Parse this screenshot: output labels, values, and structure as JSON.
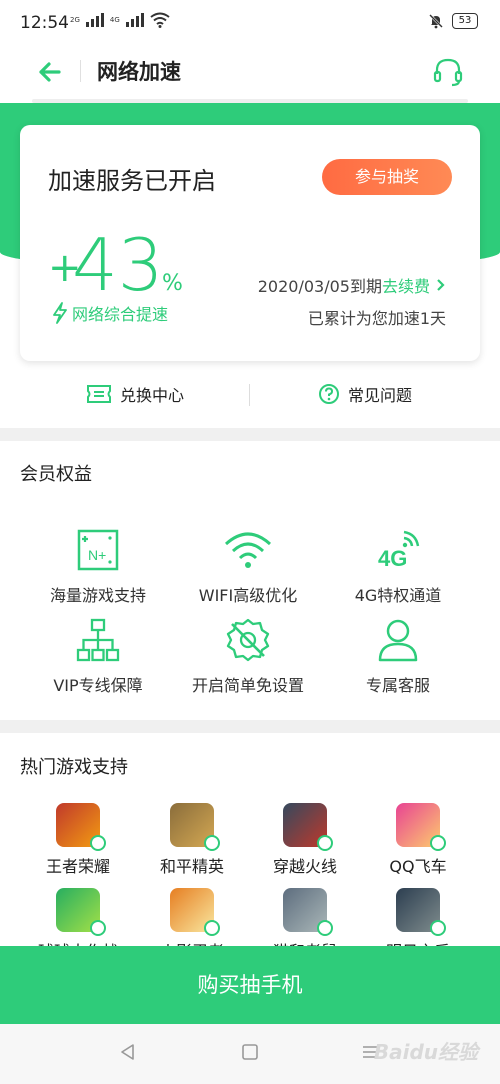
{
  "status_bar": {
    "time": "12:54",
    "network_1": "2G",
    "network_2": "4G",
    "battery": "53"
  },
  "nav": {
    "title": "网络加速"
  },
  "card": {
    "title": "加速服务已开启",
    "lottery_button": "参与抽奖",
    "speed_plus": "+",
    "speed_value": "43",
    "speed_unit": "%",
    "speed_label": "网络综合提速",
    "expire_date": "2020/03/05到期",
    "renew_link": "去续费",
    "accumulated": "已累计为您加速1天"
  },
  "quick_links": {
    "exchange": "兑换中心",
    "faq": "常见问题"
  },
  "benefits": {
    "title": "会员权益",
    "items": [
      {
        "label": "海量游戏支持",
        "icon": "game-library-icon"
      },
      {
        "label": "WIFI高级优化",
        "icon": "wifi-icon"
      },
      {
        "label": "4G特权通道",
        "icon": "4g-signal-icon"
      },
      {
        "label": "VIP专线保障",
        "icon": "network-tree-icon"
      },
      {
        "label": "开启简单免设置",
        "icon": "no-settings-icon"
      },
      {
        "label": "专属客服",
        "icon": "person-icon"
      }
    ],
    "icon_4g_text": "4G",
    "icon_game_text": "N+"
  },
  "hot_games": {
    "title": "热门游戏支持",
    "items": [
      {
        "label": "王者荣耀",
        "color": "#c0392b"
      },
      {
        "label": "和平精英",
        "color": "#8a6d3b"
      },
      {
        "label": "穿越火线",
        "color": "#34495e"
      },
      {
        "label": "QQ飞车",
        "color": "#e84393"
      },
      {
        "label": "球球大作战",
        "color": "#27ae60"
      },
      {
        "label": "火影忍者",
        "color": "#e67e22"
      },
      {
        "label": "猫和老鼠",
        "color": "#5d6d7e"
      },
      {
        "label": "明日之后",
        "color": "#2c3e50"
      }
    ]
  },
  "buy_button": "购买抽手机",
  "watermark": "Baidu经验",
  "colors": {
    "accent": "#2ecc7a",
    "lottery": "#ff7a4d"
  }
}
